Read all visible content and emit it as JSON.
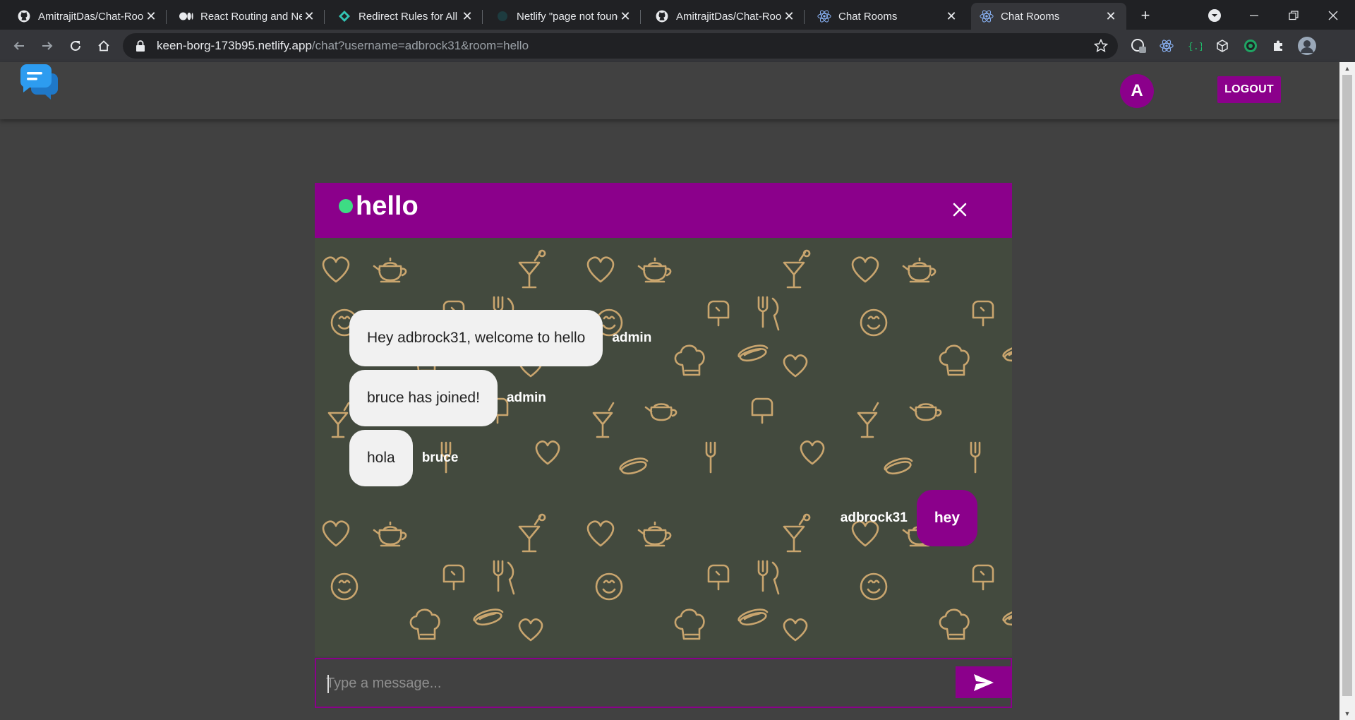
{
  "browser": {
    "tabs": [
      {
        "title": "AmitrajitDas/Chat-Room",
        "icon": "github-icon"
      },
      {
        "title": "React Routing and Netlify",
        "icon": "medium-icon"
      },
      {
        "title": "Redirect Rules for All",
        "icon": "netlify-icon"
      },
      {
        "title": "Netlify \"page not found\"",
        "icon": "netlify-icon"
      },
      {
        "title": "AmitrajitDas/Chat-Room",
        "icon": "github-icon"
      },
      {
        "title": "Chat Rooms",
        "icon": "react-icon"
      },
      {
        "title": "Chat Rooms",
        "icon": "react-icon",
        "active": true
      }
    ],
    "url_host": "keen-borg-173b95.netlify.app",
    "url_rest": "/chat?username=adbrock31&room=hello"
  },
  "header": {
    "avatar_letter": "A",
    "logout_label": "LOGOUT"
  },
  "room": {
    "name": "hello",
    "status_color": "#3ddc84"
  },
  "messages": [
    {
      "text": "Hey adbrock31, welcome to hello",
      "user": "admin",
      "mine": false
    },
    {
      "text": "bruce has joined!",
      "user": "admin",
      "mine": false
    },
    {
      "text": "hola",
      "user": "bruce",
      "mine": false
    },
    {
      "text": "hey",
      "user": "adbrock31",
      "mine": true
    }
  ],
  "composer": {
    "placeholder": "Type a message..."
  },
  "colors": {
    "accent": "#8b008b",
    "chat_bg": "#434a3e",
    "doodle": "#c9a56e",
    "page_bg": "#414141"
  }
}
